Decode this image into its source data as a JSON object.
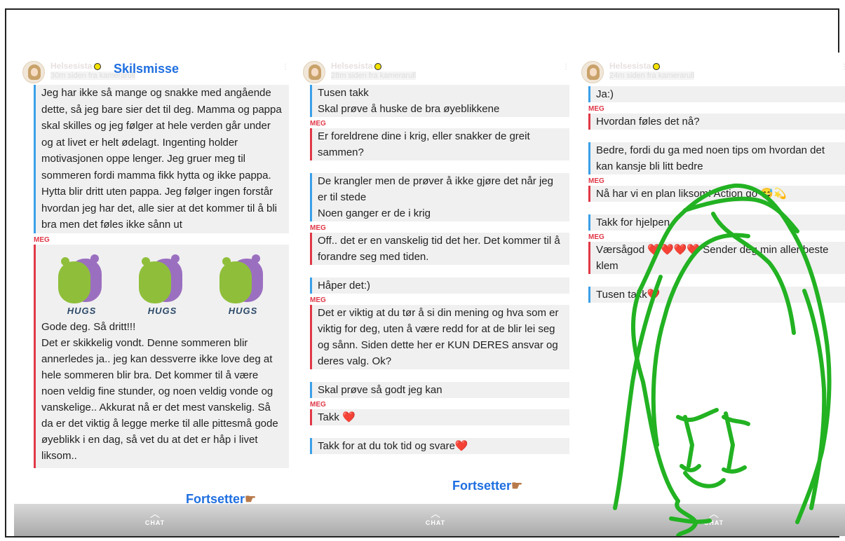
{
  "panels": [
    {
      "username": "Helsesista",
      "since": "30m siden fra kamerarull",
      "topic": "Skilsmisse",
      "messages": [
        {
          "who": "them",
          "text": "Jeg har ikke så mange og snakke med angående dette, så jeg bare sier det til deg. Mamma og pappa skal skilles og jeg følger at hele verden går under og at livet er helt ødelagt. Ingenting holder motivasjonen oppe lenger. Jeg gruer meg til sommeren fordi mamma fikk hytta og ikke pappa. Hytta blir dritt uten pappa. Jeg følger ingen forstår hvordan jeg har det, alle sier at det kommer til å bli bra men det føles ikke sånn ut"
        }
      ],
      "me_label": "MEG",
      "hug_label": "HUGS",
      "reply": "Gode deg. Så dritt!!!\nDet er skikkelig vondt. Denne sommeren blir annerledes ja.. jeg kan dessverre ikke love deg at hele sommeren blir bra. Det kommer til å være noen veldig fine stunder, og noen veldig vonde og vanskelige.. Akkurat nå er det mest vanskelig. Så da er det viktig å legge merke til alle pittesmå gode øyeblikk i en dag, så vet du at det er håp i livet liksom..",
      "continue": "Fortsetter",
      "chat": "CHAT"
    },
    {
      "username": "Helsesista",
      "since": "28m siden fra kamerarull",
      "messages": [
        {
          "who": "them",
          "lines": [
            "Tusen takk",
            "Skal prøve å huske de bra øyeblikkene"
          ]
        },
        {
          "who": "me",
          "lines": [
            "Er foreldrene dine i krig, eller snakker de greit sammen?"
          ]
        },
        {
          "who": "them",
          "lines": [
            "De krangler men de prøver å ikke gjøre det når jeg er til stede",
            "Noen ganger er de i krig"
          ]
        },
        {
          "who": "me",
          "lines": [
            "Off.. det er en vanskelig tid det her. Det kommer til å forandre seg med tiden."
          ]
        },
        {
          "who": "them",
          "lines": [
            "Håper det:)"
          ]
        },
        {
          "who": "me",
          "lines": [
            "Det er viktig at du tør å si din mening og hva som er viktig for deg, uten å være redd for at de blir lei seg og sånn. Siden dette her er KUN DERES ansvar og deres valg. Ok?"
          ]
        },
        {
          "who": "them",
          "lines": [
            "Skal prøve så godt jeg kan"
          ]
        },
        {
          "who": "me",
          "lines": [
            "Takk ❤️"
          ]
        },
        {
          "who": "them",
          "lines": [
            "Takk for at du tok tid og svare❤️"
          ]
        }
      ],
      "me_label": "MEG",
      "continue": "Fortsetter",
      "chat": "CHAT"
    },
    {
      "username": "Helsesista",
      "since": "24m siden fra kamerarull",
      "messages": [
        {
          "who": "them",
          "lines": [
            "Ja:)"
          ]
        },
        {
          "who": "me",
          "lines": [
            "Hvordan føles det nå?"
          ]
        },
        {
          "who": "them",
          "lines": [
            "Bedre, fordi du ga med noen tips om hvordan det kan kansje bli litt bedre"
          ]
        },
        {
          "who": "me",
          "lines": [
            "Nå har vi en plan liksom! Action go 😅💫"
          ]
        },
        {
          "who": "them",
          "lines": [
            "Takk for hjelpen"
          ]
        },
        {
          "who": "me",
          "lines": [
            "Værsågod ❤️❤️❤️❤️ Sender deg min aller beste klem"
          ]
        },
        {
          "who": "them",
          "lines": [
            "Tusen takk❤️"
          ]
        }
      ],
      "me_label": "MEG",
      "chat": "CHAT"
    }
  ],
  "colors": {
    "them": "#3aa0e8",
    "me": "#e03848",
    "accent": "#1f6fe0",
    "drawing": "#22b222"
  }
}
